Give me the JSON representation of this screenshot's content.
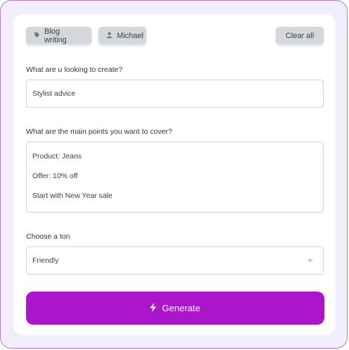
{
  "chips": {
    "blog_label": "Blog writing",
    "blog_icon": "tag-icon",
    "user_label": "Michael",
    "user_icon": "person-icon",
    "clear_label": "Clear all"
  },
  "create": {
    "label": "What are u looking to create?",
    "value": "Stylist advice"
  },
  "points": {
    "label": "What are the main points you want to cover?",
    "lines": [
      "Product: Jeans",
      "Offer: 10% off",
      "Start with New Year sale"
    ]
  },
  "tone": {
    "label": "Choose a ton",
    "selected": "Friendly",
    "icon": "chevron-down-icon"
  },
  "generate": {
    "label": "Generate",
    "icon": "lightning-icon"
  },
  "colors": {
    "accent": "#ab16cc",
    "chip_bg": "#d4d7dc",
    "frame_border": "#b07be0",
    "frame_bg": "#f1eefc"
  }
}
